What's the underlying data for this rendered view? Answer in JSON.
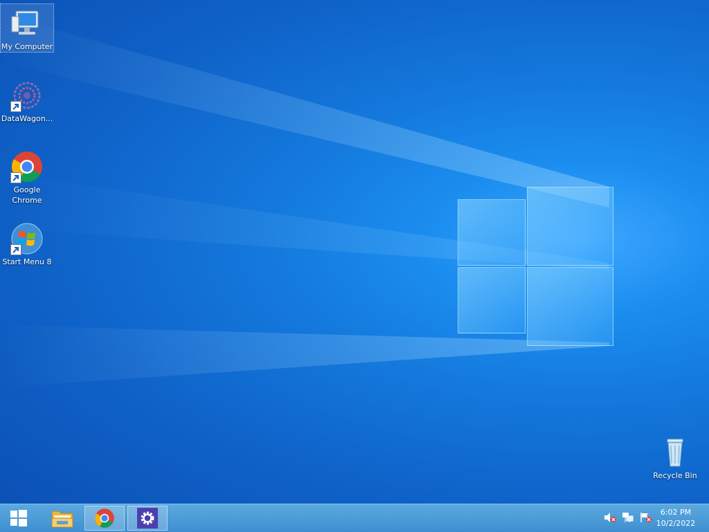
{
  "desktop": {
    "icons": [
      {
        "label": "My Computer"
      },
      {
        "label": "DataWagon..."
      },
      {
        "label": "Google Chrome"
      },
      {
        "label": "Start Menu 8"
      },
      {
        "label": "Recycle Bin"
      }
    ]
  },
  "taskbar": {
    "buttons": [
      {
        "icon": "windows-start-icon"
      },
      {
        "icon": "file-explorer-icon"
      },
      {
        "icon": "chrome-icon"
      },
      {
        "icon": "settings-gear-icon"
      }
    ],
    "tray": {
      "icons": [
        "volume-muted-icon",
        "network-icon",
        "action-center-flag-icon"
      ]
    },
    "clock": {
      "time": "6:02 PM",
      "date": "10/2/2022"
    }
  },
  "colors": {
    "accent": "#1479dd",
    "taskbar": "#4a9bd6"
  }
}
